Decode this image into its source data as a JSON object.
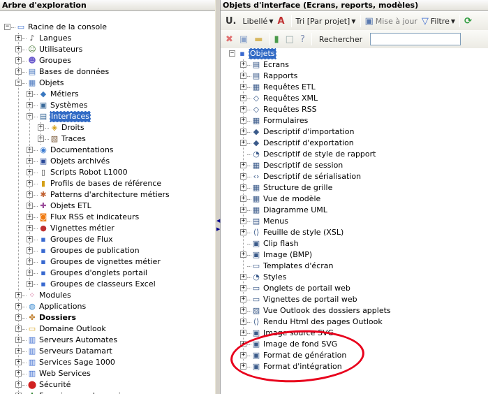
{
  "left_panel": {
    "title": "Arbre d'exploration",
    "items": [
      {
        "label": "Racine de la console",
        "icon": "console-icon",
        "color": "#3b6fd0"
      },
      {
        "label": "Langues",
        "icon": "languages-icon",
        "color": "#444444"
      },
      {
        "label": "Utilisateurs",
        "icon": "users-icon",
        "color": "#4a7a3a"
      },
      {
        "label": "Groupes",
        "icon": "groups-icon",
        "color": "#6a5acd"
      },
      {
        "label": "Bases de données",
        "icon": "database-icon",
        "color": "#4a78c0"
      },
      {
        "label": "Objets",
        "icon": "objects-icon",
        "color": "#4a78c0"
      },
      {
        "label": "Métiers",
        "icon": "business-icon",
        "color": "#3a78c0"
      },
      {
        "label": "Systèmes",
        "icon": "systems-icon",
        "color": "#3a6a9a"
      },
      {
        "label": "Interfaces",
        "icon": "interfaces-icon",
        "color": "#3a6a9a"
      },
      {
        "label": "Droits",
        "icon": "rights-icon",
        "color": "#d4a017"
      },
      {
        "label": "Traces",
        "icon": "traces-icon",
        "color": "#7a5a3a"
      },
      {
        "label": "Documentations",
        "icon": "documentation-icon",
        "color": "#3a7ad0"
      },
      {
        "label": "Objets archivés",
        "icon": "archive-icon",
        "color": "#2a4a9a"
      },
      {
        "label": "Scripts Robot L1000",
        "icon": "script-icon",
        "color": "#333333"
      },
      {
        "label": "Profils de bases de référence",
        "icon": "profile-icon",
        "color": "#d4a017"
      },
      {
        "label": "Patterns d'architecture métiers",
        "icon": "pattern-icon",
        "color": "#c06030"
      },
      {
        "label": "Objets ETL",
        "icon": "etl-icon",
        "color": "#9a4a9a"
      },
      {
        "label": "Flux RSS et indicateurs",
        "icon": "rss-icon",
        "color": "#f07a10"
      },
      {
        "label": "Vignettes métier",
        "icon": "vignette-icon",
        "color": "#c03030"
      },
      {
        "label": "Groupes de Flux",
        "icon": "flow-group-icon",
        "color": "#3a6ad0"
      },
      {
        "label": "Groupes de publication",
        "icon": "publication-group-icon",
        "color": "#3a6ad0"
      },
      {
        "label": "Groupes de vignettes métier",
        "icon": "vignette-group-icon",
        "color": "#3a6ad0"
      },
      {
        "label": "Groupes d'onglets portail",
        "icon": "portal-tab-group-icon",
        "color": "#3a6ad0"
      },
      {
        "label": "Groupes de classeurs Excel",
        "icon": "excel-group-icon",
        "color": "#3a6ad0"
      },
      {
        "label": "Modules",
        "icon": "modules-icon",
        "color": "#c03070"
      },
      {
        "label": "Applications",
        "icon": "applications-icon",
        "color": "#3a8ad0"
      },
      {
        "label": "Dossiers",
        "icon": "folders-icon",
        "color": "#c08030"
      },
      {
        "label": "Domaine Outlook",
        "icon": "outlook-icon",
        "color": "#d4a017"
      },
      {
        "label": "Serveurs Automates",
        "icon": "automation-server-icon",
        "color": "#3a6ad0"
      },
      {
        "label": "Serveurs Datamart",
        "icon": "datamart-server-icon",
        "color": "#3a6ad0"
      },
      {
        "label": "Services Sage 1000",
        "icon": "sage-services-icon",
        "color": "#3a6ad0"
      },
      {
        "label": "Web Services",
        "icon": "web-services-icon",
        "color": "#3a6ad0"
      },
      {
        "label": "Sécurité",
        "icon": "security-icon",
        "color": "#d02020"
      },
      {
        "label": "Fournisseurs de services",
        "icon": "service-providers-icon",
        "color": "#3a8a3a"
      }
    ]
  },
  "right_panel": {
    "title": "Objets d'interface (Ecrans, reports, modèles)",
    "toolbar1": {
      "libelle": "Libellé",
      "tri": "Tri [Par projet]",
      "mise_a_jour": "Mise à jour",
      "filtre": "Filtre"
    },
    "toolbar2": {
      "rechercher": "Rechercher",
      "search_value": ""
    },
    "root_label": "Objets",
    "items": [
      {
        "label": "Ecrans",
        "icon": "screen-icon"
      },
      {
        "label": "Rapports",
        "icon": "report-icon"
      },
      {
        "label": "Requêtes ETL",
        "icon": "etl-query-icon"
      },
      {
        "label": "Requêtes XML",
        "icon": "xml-query-icon"
      },
      {
        "label": "Requêtes RSS",
        "icon": "rss-query-icon"
      },
      {
        "label": "Formulaires",
        "icon": "form-icon"
      },
      {
        "label": "Descriptif d'importation",
        "icon": "import-icon"
      },
      {
        "label": "Descriptif d'exportation",
        "icon": "export-icon"
      },
      {
        "label": "Descriptif de style de rapport",
        "icon": "report-style-icon"
      },
      {
        "label": "Descriptif de session",
        "icon": "session-icon"
      },
      {
        "label": "Descriptif de sérialisation",
        "icon": "serialization-icon"
      },
      {
        "label": "Structure de grille",
        "icon": "grid-icon"
      },
      {
        "label": "Vue de modèle",
        "icon": "model-view-icon"
      },
      {
        "label": "Diagramme UML",
        "icon": "uml-icon"
      },
      {
        "label": "Menus",
        "icon": "menu-icon"
      },
      {
        "label": "Feuille de style (XSL)",
        "icon": "xsl-icon"
      },
      {
        "label": "Clip flash",
        "icon": "flash-icon"
      },
      {
        "label": "Image (BMP)",
        "icon": "image-icon"
      },
      {
        "label": "Templates d'écran",
        "icon": "template-icon"
      },
      {
        "label": "Styles",
        "icon": "styles-icon"
      },
      {
        "label": "Onglets de portail web",
        "icon": "portal-tab-icon"
      },
      {
        "label": "Vignettes de portail web",
        "icon": "portal-vignette-icon"
      },
      {
        "label": "Vue Outlook des dossiers applets",
        "icon": "outlook-view-icon"
      },
      {
        "label": "Rendu Html des pages Outlook",
        "icon": "html-render-icon"
      },
      {
        "label": "Image source SVG",
        "icon": "svg-source-icon"
      },
      {
        "label": "Image de fond SVG",
        "icon": "svg-background-icon"
      },
      {
        "label": "Format de génération",
        "icon": "generation-format-icon"
      },
      {
        "label": "Format d'intégration",
        "icon": "integration-format-icon"
      }
    ]
  },
  "colors": {
    "selection": "#316ac5",
    "annotation_ring": "#e8001c",
    "title_bar": "#e4e2da"
  }
}
